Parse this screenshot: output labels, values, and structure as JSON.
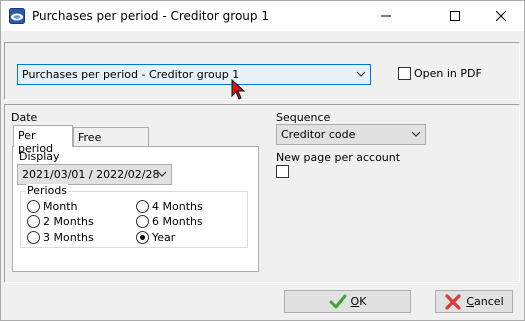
{
  "window": {
    "title": "Purchases per period - Creditor group 1"
  },
  "report": {
    "selected": "Purchases per period - Creditor group 1",
    "open_pdf_label": "Open in PDF",
    "open_pdf_checked": false
  },
  "date_section": {
    "label": "Date",
    "tabs": [
      {
        "label": "Per period",
        "active": true
      },
      {
        "label": "Free selection",
        "active": false
      }
    ],
    "display_label": "Display",
    "display_value": "2021/03/01 / 2022/02/28",
    "periods_label": "Periods",
    "periods": [
      {
        "label": "Month",
        "checked": false
      },
      {
        "label": "2 Months",
        "checked": false
      },
      {
        "label": "3 Months",
        "checked": false
      },
      {
        "label": "4 Months",
        "checked": false
      },
      {
        "label": "6 Months",
        "checked": false
      },
      {
        "label": "Year",
        "checked": true
      }
    ]
  },
  "sequence": {
    "label": "Sequence",
    "value": "Creditor code"
  },
  "new_page": {
    "label": "New page per account",
    "checked": false
  },
  "buttons": {
    "ok_prefix": "",
    "ok_underlined": "O",
    "ok_rest": "K",
    "cancel_underlined": "C",
    "cancel_rest": "ancel"
  },
  "colors": {
    "accent": "#0078d7",
    "ok_icon": "#3aa832",
    "cancel_icon": "#d93a3a",
    "cursor": "#cc1a1a"
  }
}
